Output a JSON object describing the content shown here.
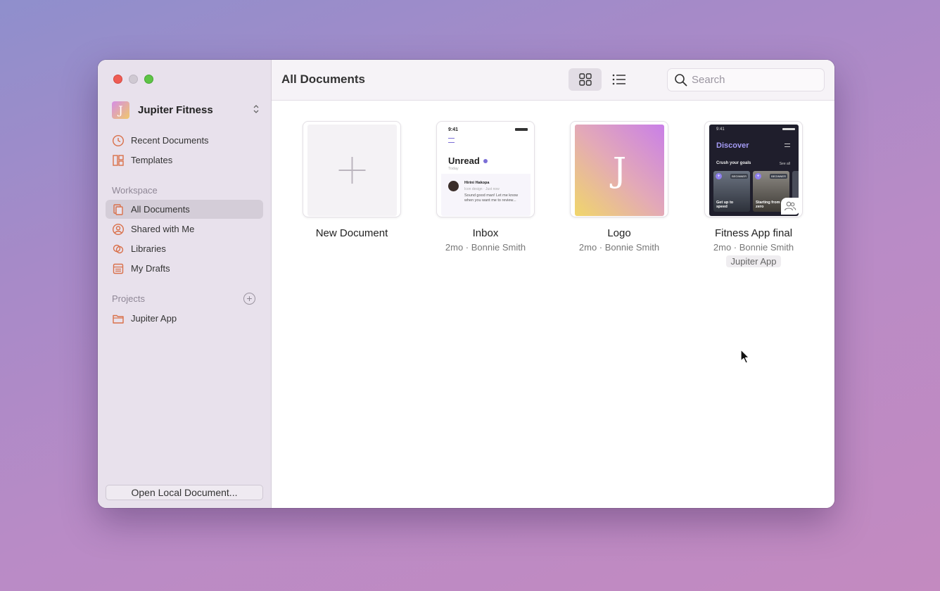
{
  "window_controls": {
    "close": "close",
    "minimize": "minimize",
    "zoom": "zoom"
  },
  "team": {
    "initial": "J",
    "name": "Jupiter Fitness"
  },
  "sidebar": {
    "top_items": [
      {
        "label": "Recent Documents",
        "icon": "clock-icon"
      },
      {
        "label": "Templates",
        "icon": "templates-icon"
      }
    ],
    "workspace_heading": "Workspace",
    "workspace_items": [
      {
        "label": "All Documents",
        "icon": "documents-icon",
        "active": true
      },
      {
        "label": "Shared with Me",
        "icon": "person-icon"
      },
      {
        "label": "Libraries",
        "icon": "libraries-icon"
      },
      {
        "label": "My Drafts",
        "icon": "drafts-icon"
      }
    ],
    "projects_heading": "Projects",
    "projects_add": "+",
    "projects": [
      {
        "label": "Jupiter App",
        "icon": "folder-icon"
      }
    ],
    "open_local": "Open Local Document..."
  },
  "toolbar": {
    "title": "All Documents",
    "view_mode": "grid",
    "search_placeholder": "Search"
  },
  "documents": [
    {
      "title": "New Document",
      "meta": ""
    },
    {
      "title": "Inbox",
      "meta": "2mo · Bonnie Smith",
      "thumb": {
        "time": "9:41",
        "heading": "Unread",
        "sub": "Today",
        "sender": "Hirini Hakopa",
        "role": "Icon design · Just now",
        "msg": "Sound good man! Let me know when you want me to review..."
      }
    },
    {
      "title": "Logo",
      "meta": "2mo · Bonnie Smith",
      "thumb": {
        "letter": "J"
      }
    },
    {
      "title": "Fitness App final",
      "meta": "2mo · Bonnie Smith",
      "project": "Jupiter App",
      "thumb": {
        "time": "9:41",
        "heading": "Discover",
        "section": "Crush your goals",
        "see_all": "See all",
        "tag": "BEGINNER",
        "card1": "Get up to speed",
        "card2": "Starting from zero"
      }
    }
  ],
  "colors": {
    "accent": "#d9704a",
    "sidebar_bg": "#e8e1ec",
    "logo_gradient": [
      "#f0d66a",
      "#c97fe8"
    ]
  }
}
